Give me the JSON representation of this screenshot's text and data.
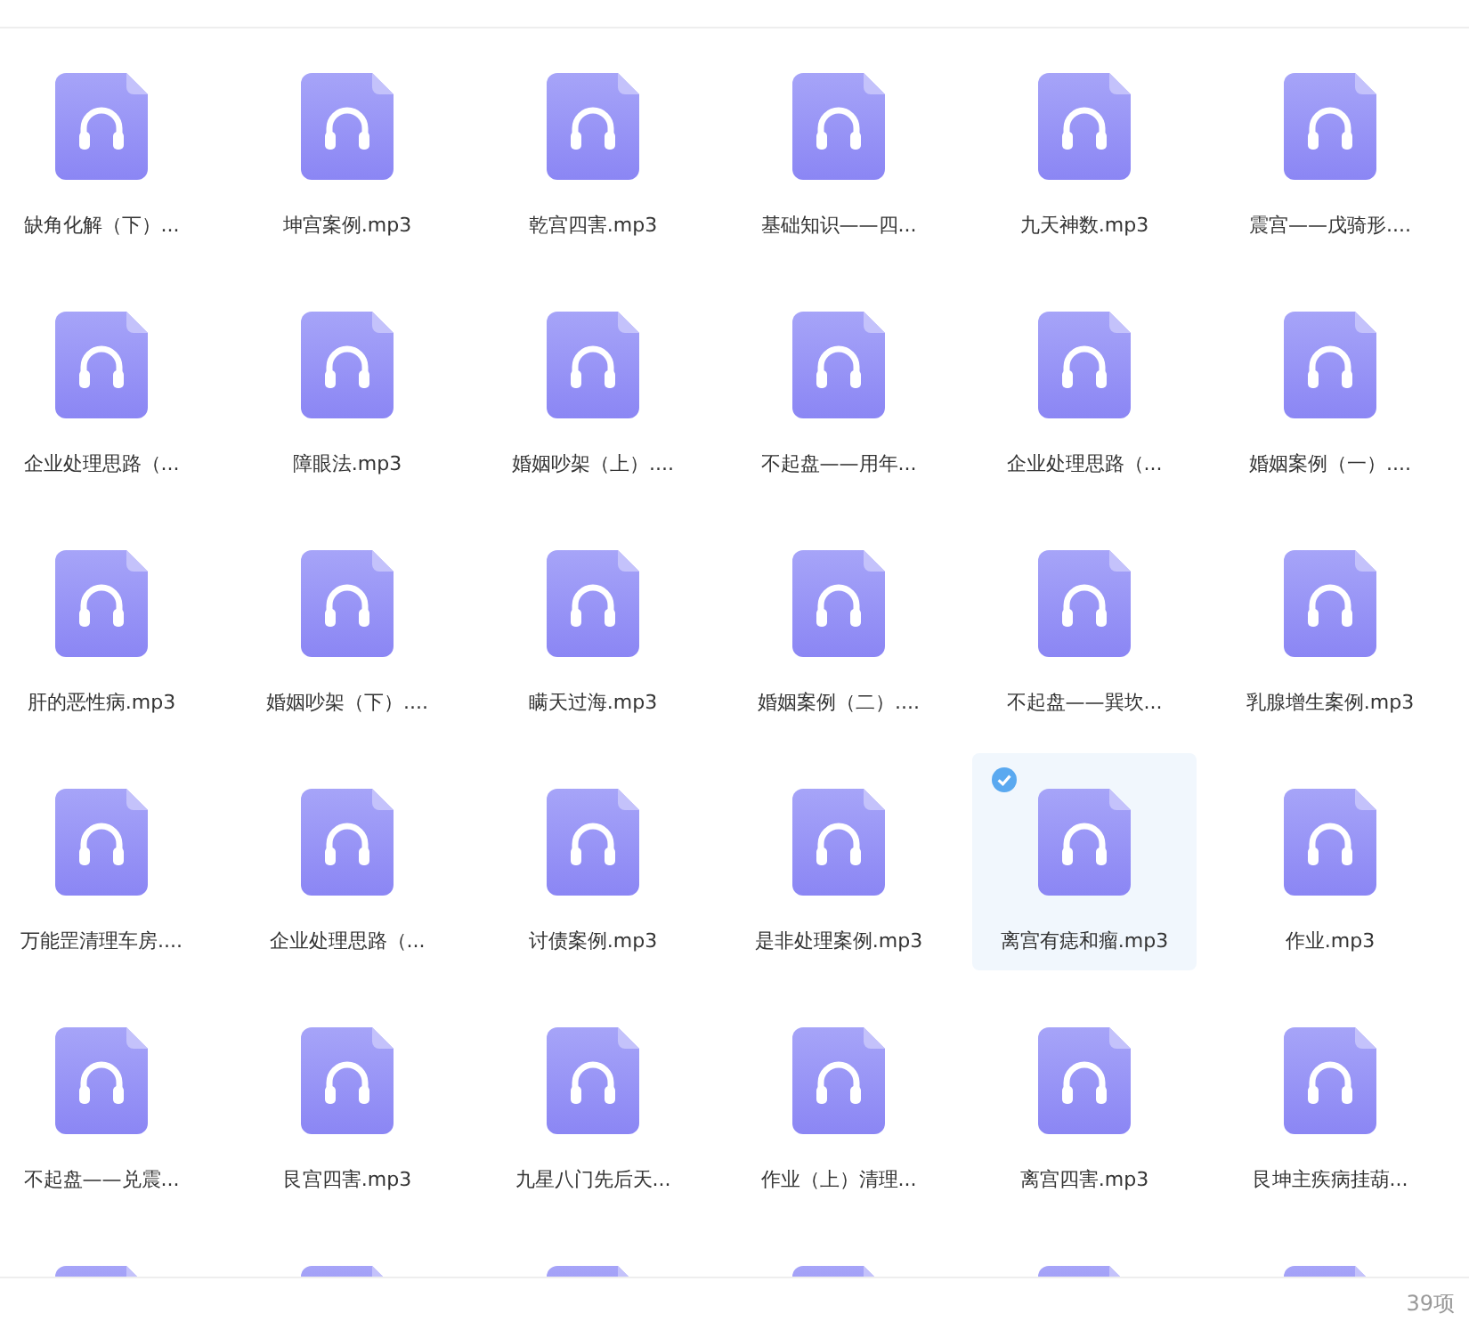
{
  "files": [
    {
      "kind": "audio",
      "name": "缺角化解（下）...",
      "selected": false
    },
    {
      "kind": "audio",
      "name": "坤宫案例.mp3",
      "selected": false
    },
    {
      "kind": "audio",
      "name": "乾宫四害.mp3",
      "selected": false
    },
    {
      "kind": "audio",
      "name": "基础知识——四...",
      "selected": false
    },
    {
      "kind": "audio",
      "name": "九天神数.mp3",
      "selected": false
    },
    {
      "kind": "audio",
      "name": "震宫——戊骑形....",
      "selected": false
    },
    {
      "kind": "audio",
      "name": "企业处理思路（...",
      "selected": false
    },
    {
      "kind": "audio",
      "name": "障眼法.mp3",
      "selected": false
    },
    {
      "kind": "audio",
      "name": "婚姻吵架（上）....",
      "selected": false
    },
    {
      "kind": "audio",
      "name": "不起盘——用年...",
      "selected": false
    },
    {
      "kind": "audio",
      "name": "企业处理思路（...",
      "selected": false
    },
    {
      "kind": "audio",
      "name": "婚姻案例（一）....",
      "selected": false
    },
    {
      "kind": "audio",
      "name": "肝的恶性病.mp3",
      "selected": false
    },
    {
      "kind": "audio",
      "name": "婚姻吵架（下）....",
      "selected": false
    },
    {
      "kind": "audio",
      "name": "瞒天过海.mp3",
      "selected": false
    },
    {
      "kind": "audio",
      "name": "婚姻案例（二）....",
      "selected": false
    },
    {
      "kind": "audio",
      "name": "不起盘——巽坎...",
      "selected": false
    },
    {
      "kind": "audio",
      "name": "乳腺增生案例.mp3",
      "selected": false
    },
    {
      "kind": "audio",
      "name": "万能罡清理车房....",
      "selected": false
    },
    {
      "kind": "audio",
      "name": "企业处理思路（...",
      "selected": false
    },
    {
      "kind": "audio",
      "name": "讨债案例.mp3",
      "selected": false
    },
    {
      "kind": "audio",
      "name": "是非处理案例.mp3",
      "selected": false
    },
    {
      "kind": "audio",
      "name": "离宫有痣和瘤.mp3",
      "selected": true
    },
    {
      "kind": "audio",
      "name": "作业.mp3",
      "selected": false
    },
    {
      "kind": "audio",
      "name": "不起盘——兑震...",
      "selected": false
    },
    {
      "kind": "audio",
      "name": "艮宫四害.mp3",
      "selected": false
    },
    {
      "kind": "audio",
      "name": "九星八门先后天...",
      "selected": false
    },
    {
      "kind": "audio",
      "name": "作业（上）清理...",
      "selected": false
    },
    {
      "kind": "audio",
      "name": "离宫四害.mp3",
      "selected": false
    },
    {
      "kind": "audio",
      "name": "艮坤主疾病挂葫...",
      "selected": false
    },
    {
      "kind": "audio",
      "selected": false
    },
    {
      "kind": "audio",
      "selected": false
    },
    {
      "kind": "audio",
      "selected": false
    },
    {
      "kind": "audio",
      "selected": false
    },
    {
      "kind": "audio",
      "selected": false
    },
    {
      "kind": "audio",
      "selected": false
    }
  ],
  "status_bar": {
    "count": "39项"
  }
}
